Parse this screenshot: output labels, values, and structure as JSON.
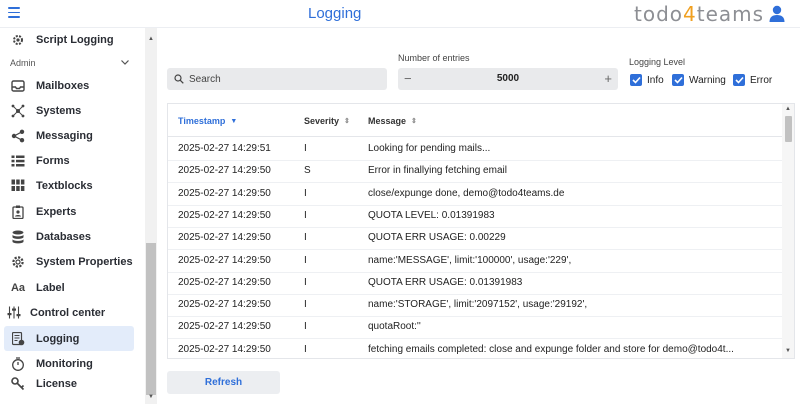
{
  "header": {
    "title": "Logging",
    "brand_prefix": "todo",
    "brand_four": "4",
    "brand_suffix": "teams"
  },
  "sidebar": {
    "top_item": "Script Logging",
    "section": "Admin",
    "items": [
      {
        "label": "Mailboxes",
        "icon": "inbox-icon"
      },
      {
        "label": "Systems",
        "icon": "network-icon"
      },
      {
        "label": "Messaging",
        "icon": "share-icon"
      },
      {
        "label": "Forms",
        "icon": "list-icon"
      },
      {
        "label": "Textblocks",
        "icon": "grid-icon"
      },
      {
        "label": "Experts",
        "icon": "badge-icon"
      },
      {
        "label": "Databases",
        "icon": "database-icon"
      },
      {
        "label": "System Properties",
        "icon": "gear-icon"
      },
      {
        "label": "Label",
        "icon": "text-icon"
      },
      {
        "label": "Control center",
        "icon": "sliders-icon"
      },
      {
        "label": "Logging",
        "icon": "log-icon"
      },
      {
        "label": "Monitoring",
        "icon": "stopwatch-icon"
      },
      {
        "label": "License",
        "icon": "key-icon"
      }
    ]
  },
  "filters": {
    "search_placeholder": "Search",
    "entries_label": "Number of entries",
    "entries_value": "5000",
    "level_label": "Logging Level",
    "levels": [
      {
        "label": "Info",
        "checked": true
      },
      {
        "label": "Warning",
        "checked": true
      },
      {
        "label": "Error",
        "checked": true
      }
    ]
  },
  "table": {
    "headers": [
      "Timestamp",
      "Severity",
      "Message"
    ],
    "rows": [
      {
        "ts": "2025-02-27 14:29:51",
        "sev": "I",
        "msg": "Looking for pending mails..."
      },
      {
        "ts": "2025-02-27 14:29:50",
        "sev": "S",
        "msg": "Error in finallying fetching email"
      },
      {
        "ts": "2025-02-27 14:29:50",
        "sev": "I",
        "msg": "close/expunge done, demo@todo4teams.de"
      },
      {
        "ts": "2025-02-27 14:29:50",
        "sev": "I",
        "msg": "QUOTA LEVEL: 0.01391983"
      },
      {
        "ts": "2025-02-27 14:29:50",
        "sev": "I",
        "msg": "QUOTA ERR USAGE: 0.00229"
      },
      {
        "ts": "2025-02-27 14:29:50",
        "sev": "I",
        "msg": "name:'MESSAGE', limit:'100000', usage:'229',"
      },
      {
        "ts": "2025-02-27 14:29:50",
        "sev": "I",
        "msg": "QUOTA ERR USAGE: 0.01391983"
      },
      {
        "ts": "2025-02-27 14:29:50",
        "sev": "I",
        "msg": "name:'STORAGE', limit:'2097152', usage:'29192',"
      },
      {
        "ts": "2025-02-27 14:29:50",
        "sev": "I",
        "msg": "quotaRoot:''"
      },
      {
        "ts": "2025-02-27 14:29:50",
        "sev": "I",
        "msg": "fetching emails completed: close and expunge folder and store for demo@todo4t..."
      }
    ]
  },
  "actions": {
    "refresh_label": "Refresh"
  },
  "colors": {
    "accent": "#2f6fd9",
    "brand_four": "#f0a020",
    "active_bg": "#e3ecfa"
  }
}
